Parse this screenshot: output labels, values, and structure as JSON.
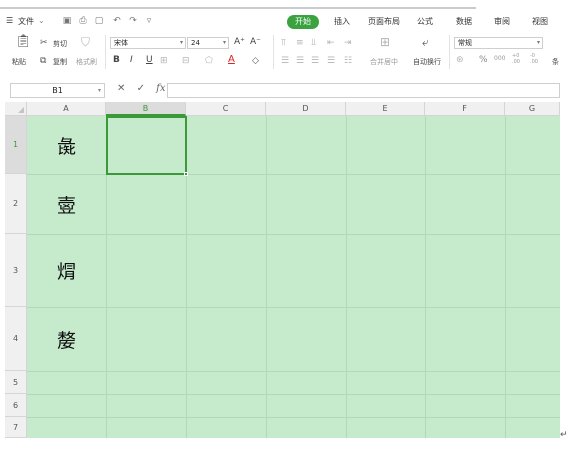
{
  "menu": {
    "file_label": "文件",
    "tabs": [
      "开始",
      "插入",
      "页面布局",
      "公式",
      "数据",
      "审阅",
      "视图"
    ]
  },
  "ribbon": {
    "paste": "粘贴",
    "cut": "剪切",
    "copy": "复制",
    "format_painter": "格式刷",
    "font_name": "宋体",
    "font_size": "24",
    "grow_font": "A⁺",
    "shrink_font": "A⁻",
    "bold": "B",
    "italic": "I",
    "underline": "U",
    "merge_center": "合并居中",
    "wrap_text": "自动换行",
    "number_format": "常规",
    "percent": "%",
    "thousands": "000",
    "inc_decimal": "+0 .00",
    "dec_decimal": "-0 .00",
    "cut_overflow": "条"
  },
  "formula_bar": {
    "name_box": "B1",
    "formula": ""
  },
  "columns": [
    "A",
    "B",
    "C",
    "D",
    "E",
    "F",
    "G"
  ],
  "rows": [
    {
      "num": "1",
      "a": "彘"
    },
    {
      "num": "2",
      "a": "㚃"
    },
    {
      "num": "3",
      "a": "焨"
    },
    {
      "num": "4",
      "a": "嫠"
    },
    {
      "num": "5",
      "a": ""
    },
    {
      "num": "6",
      "a": ""
    },
    {
      "num": "7",
      "a": ""
    }
  ],
  "active_column": "B",
  "active_row": "1",
  "colors": {
    "accent": "#3aa33f",
    "cell_fill": "#c6eacc",
    "gridline": "#b3d7b9"
  }
}
